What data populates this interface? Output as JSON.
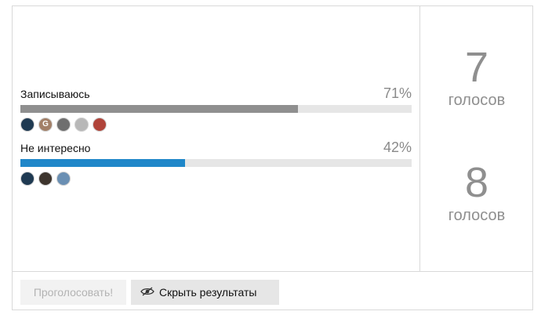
{
  "poll": {
    "options": [
      {
        "label": "Записываюсь",
        "percent_text": "71%",
        "percent": 71,
        "bar_color": "#8f8f8f",
        "voters": [
          {
            "name": "avatar-1",
            "color": "#1f3a52",
            "initial": ""
          },
          {
            "name": "avatar-2",
            "color": "#a38068",
            "initial": "G"
          },
          {
            "name": "avatar-3",
            "color": "#6f6f6f",
            "initial": ""
          },
          {
            "name": "avatar-4",
            "color": "#b8b8b8",
            "initial": ""
          },
          {
            "name": "avatar-5",
            "color": "#b0443a",
            "initial": ""
          }
        ]
      },
      {
        "label": "Не интересно",
        "percent_text": "42%",
        "percent": 42,
        "bar_color": "#1f87c9",
        "voters": [
          {
            "name": "avatar-1",
            "color": "#1f3a52",
            "initial": ""
          },
          {
            "name": "avatar-2",
            "color": "#3d342d",
            "initial": ""
          },
          {
            "name": "avatar-3",
            "color": "#6a8fb3",
            "initial": ""
          }
        ]
      }
    ],
    "totals": [
      {
        "count": "7",
        "word": "голосов"
      },
      {
        "count": "8",
        "word": "голосов"
      }
    ],
    "buttons": {
      "vote_label": "Проголосовать!",
      "hide_results_label": "Скрыть результаты",
      "hide_results_icon": "eye-slash-icon"
    }
  }
}
